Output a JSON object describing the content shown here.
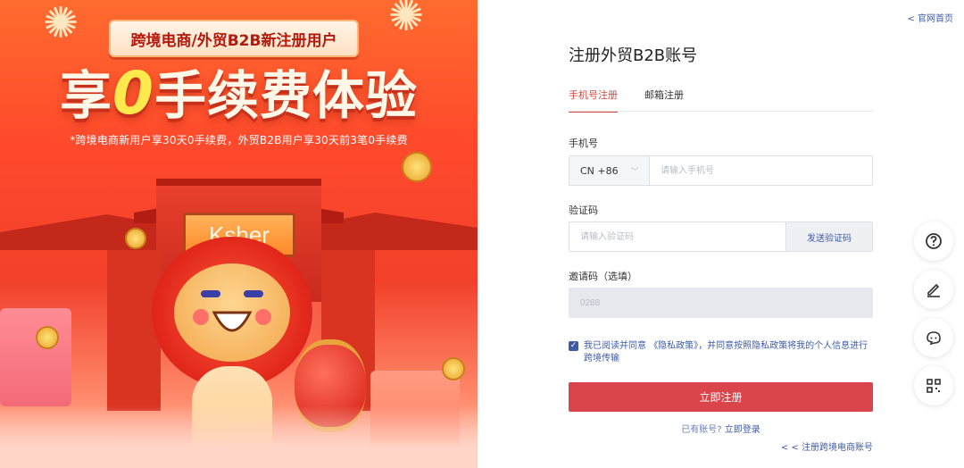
{
  "banner": {
    "tag": "跨境电商/外贸B2B新注册用户",
    "headline_prefix": "享",
    "headline_zero": "0",
    "headline_suffix": "手续费体验",
    "subtitle": "*跨境电商新用户享30天0手续费，外贸B2B用户享30天前3笔0手续费",
    "gate_sign": "Ksher"
  },
  "header": {
    "home_link": "< 官网首页"
  },
  "form": {
    "title": "注册外贸B2B账号",
    "tabs": [
      {
        "label": "手机号注册",
        "active": true
      },
      {
        "label": "邮箱注册",
        "active": false
      }
    ],
    "phone": {
      "label": "手机号",
      "country": "CN +86",
      "placeholder": "请输入手机号"
    },
    "code": {
      "label": "验证码",
      "placeholder": "请输入验证码",
      "send_label": "发送验证码"
    },
    "invite": {
      "label": "邀请码（选填）",
      "value": "0288"
    },
    "agreement": {
      "prefix": "我已阅读并同意",
      "policy_link": "《隐私政策》",
      "suffix": "，并同意按照隐私政策将我的个人信息进行跨境传输"
    },
    "submit_label": "立即注册",
    "login_prompt": "已有账号?",
    "login_link": "立即登录",
    "crossborder_link": "< < 注册跨境电商账号"
  },
  "colors": {
    "accent": "#d9454b",
    "link": "#3e5ba8"
  },
  "float_icons": [
    "help-icon",
    "edit-icon",
    "chat-icon",
    "qrcode-icon"
  ]
}
